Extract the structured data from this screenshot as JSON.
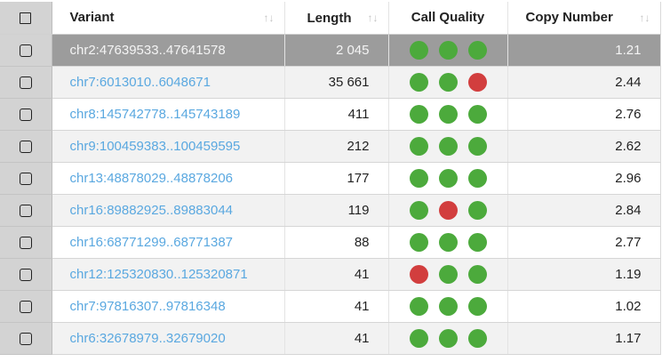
{
  "header": {
    "select_all_checked": false,
    "columns": {
      "variant": "Variant",
      "length": "Length",
      "call_quality": "Call Quality",
      "copy_number": "Copy Number"
    },
    "sort_glyph": "↑↓"
  },
  "colors": {
    "quality_good": "#4caa3c",
    "quality_bad": "#d23e3e",
    "link": "#5aa8e0",
    "selected_row": "#9c9c9c"
  },
  "rows": [
    {
      "selected": true,
      "variant": "chr2:47639533..47641578",
      "length": "2 045",
      "quality": [
        "good",
        "good",
        "good"
      ],
      "copy_number": "1.21"
    },
    {
      "selected": false,
      "variant": "chr7:6013010..6048671",
      "length": "35 661",
      "quality": [
        "good",
        "good",
        "bad"
      ],
      "copy_number": "2.44"
    },
    {
      "selected": false,
      "variant": "chr8:145742778..145743189",
      "length": "411",
      "quality": [
        "good",
        "good",
        "good"
      ],
      "copy_number": "2.76"
    },
    {
      "selected": false,
      "variant": "chr9:100459383..100459595",
      "length": "212",
      "quality": [
        "good",
        "good",
        "good"
      ],
      "copy_number": "2.62"
    },
    {
      "selected": false,
      "variant": "chr13:48878029..48878206",
      "length": "177",
      "quality": [
        "good",
        "good",
        "good"
      ],
      "copy_number": "2.96"
    },
    {
      "selected": false,
      "variant": "chr16:89882925..89883044",
      "length": "119",
      "quality": [
        "good",
        "bad",
        "good"
      ],
      "copy_number": "2.84"
    },
    {
      "selected": false,
      "variant": "chr16:68771299..68771387",
      "length": "88",
      "quality": [
        "good",
        "good",
        "good"
      ],
      "copy_number": "2.77"
    },
    {
      "selected": false,
      "variant": "chr12:125320830..125320871",
      "length": "41",
      "quality": [
        "bad",
        "good",
        "good"
      ],
      "copy_number": "1.19"
    },
    {
      "selected": false,
      "variant": "chr7:97816307..97816348",
      "length": "41",
      "quality": [
        "good",
        "good",
        "good"
      ],
      "copy_number": "1.02"
    },
    {
      "selected": false,
      "variant": "chr6:32678979..32679020",
      "length": "41",
      "quality": [
        "good",
        "good",
        "good"
      ],
      "copy_number": "1.17"
    }
  ]
}
